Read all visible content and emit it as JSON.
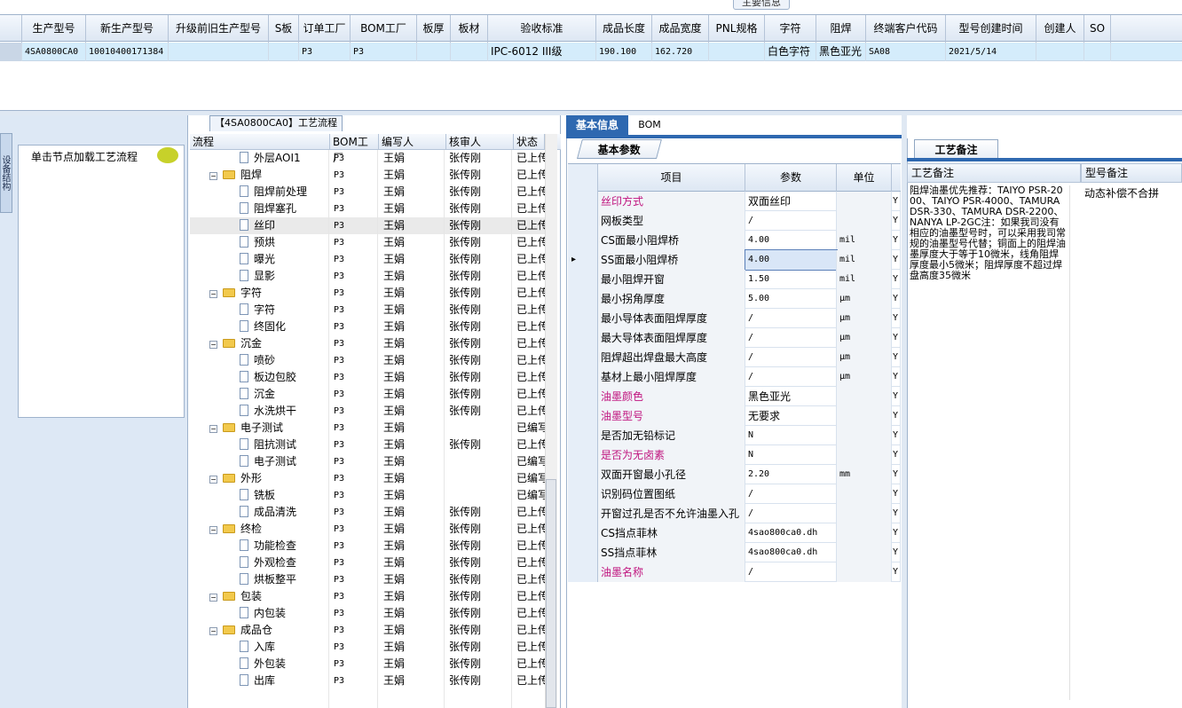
{
  "top": {
    "tab_label": "主要信息",
    "headers": [
      "生产型号",
      "新生产型号",
      "升级前旧生产型号",
      "S板",
      "订单工厂",
      "BOM工厂",
      "板厚",
      "板材",
      "验收标准",
      "成品长度",
      "成品宽度",
      "PNL规格",
      "字符",
      "阻焊",
      "终端客户代码",
      "型号创建时间",
      "创建人",
      "SO"
    ],
    "row": [
      "4SA0800CA0",
      "10010400171384",
      "",
      "",
      "P3",
      "P3",
      "",
      "",
      "IPC-6012 III级",
      "190.100",
      "162.720",
      "",
      "白色字符",
      "黑色亚光",
      "SA08",
      "2021/5/14",
      "",
      ""
    ]
  },
  "left": {
    "side_tab": "设备结构",
    "load_label": "单击节点加载工艺流程"
  },
  "tree": {
    "title": "【4SA0800CA0】工艺流程",
    "headers": [
      "流程",
      "BOM工厂",
      "编写人",
      "核审人",
      "状态"
    ],
    "rows": [
      {
        "name": "外层AOI1",
        "factory": "P3",
        "writer": "王娟",
        "reviewer": "张传刚",
        "status": "已上传",
        "level": 2
      },
      {
        "name": "阻焊",
        "factory": "P3",
        "writer": "王娟",
        "reviewer": "张传刚",
        "status": "已上传",
        "level": 1
      },
      {
        "name": "阻焊前处理",
        "factory": "P3",
        "writer": "王娟",
        "reviewer": "张传刚",
        "status": "已上传",
        "level": 2
      },
      {
        "name": "阻焊塞孔",
        "factory": "P3",
        "writer": "王娟",
        "reviewer": "张传刚",
        "status": "已上传",
        "level": 2
      },
      {
        "name": "丝印",
        "factory": "P3",
        "writer": "王娟",
        "reviewer": "张传刚",
        "status": "已上传",
        "level": 2,
        "selected": true
      },
      {
        "name": "预烘",
        "factory": "P3",
        "writer": "王娟",
        "reviewer": "张传刚",
        "status": "已上传",
        "level": 2
      },
      {
        "name": "曝光",
        "factory": "P3",
        "writer": "王娟",
        "reviewer": "张传刚",
        "status": "已上传",
        "level": 2
      },
      {
        "name": "显影",
        "factory": "P3",
        "writer": "王娟",
        "reviewer": "张传刚",
        "status": "已上传",
        "level": 2
      },
      {
        "name": "字符",
        "factory": "P3",
        "writer": "王娟",
        "reviewer": "张传刚",
        "status": "已上传",
        "level": 1
      },
      {
        "name": "字符",
        "factory": "P3",
        "writer": "王娟",
        "reviewer": "张传刚",
        "status": "已上传",
        "level": 2
      },
      {
        "name": "终固化",
        "factory": "P3",
        "writer": "王娟",
        "reviewer": "张传刚",
        "status": "已上传",
        "level": 2
      },
      {
        "name": "沉金",
        "factory": "P3",
        "writer": "王娟",
        "reviewer": "张传刚",
        "status": "已上传",
        "level": 1
      },
      {
        "name": "喷砂",
        "factory": "P3",
        "writer": "王娟",
        "reviewer": "张传刚",
        "status": "已上传",
        "level": 2
      },
      {
        "name": "板边包胶",
        "factory": "P3",
        "writer": "王娟",
        "reviewer": "张传刚",
        "status": "已上传",
        "level": 2
      },
      {
        "name": "沉金",
        "factory": "P3",
        "writer": "王娟",
        "reviewer": "张传刚",
        "status": "已上传",
        "level": 2
      },
      {
        "name": "水洗烘干",
        "factory": "P3",
        "writer": "王娟",
        "reviewer": "张传刚",
        "status": "已上传",
        "level": 2
      },
      {
        "name": "电子测试",
        "factory": "P3",
        "writer": "王娟",
        "reviewer": "",
        "status": "已编写",
        "level": 1
      },
      {
        "name": "阻抗测试",
        "factory": "P3",
        "writer": "王娟",
        "reviewer": "张传刚",
        "status": "已上传",
        "level": 2
      },
      {
        "name": "电子测试",
        "factory": "P3",
        "writer": "王娟",
        "reviewer": "",
        "status": "已编写",
        "level": 2
      },
      {
        "name": "外形",
        "factory": "P3",
        "writer": "王娟",
        "reviewer": "",
        "status": "已编写",
        "level": 1
      },
      {
        "name": "铣板",
        "factory": "P3",
        "writer": "王娟",
        "reviewer": "",
        "status": "已编写",
        "level": 2
      },
      {
        "name": "成品清洗",
        "factory": "P3",
        "writer": "王娟",
        "reviewer": "张传刚",
        "status": "已上传",
        "level": 2
      },
      {
        "name": "终检",
        "factory": "P3",
        "writer": "王娟",
        "reviewer": "张传刚",
        "status": "已上传",
        "level": 1
      },
      {
        "name": "功能检查",
        "factory": "P3",
        "writer": "王娟",
        "reviewer": "张传刚",
        "status": "已上传",
        "level": 2
      },
      {
        "name": "外观检查",
        "factory": "P3",
        "writer": "王娟",
        "reviewer": "张传刚",
        "status": "已上传",
        "level": 2
      },
      {
        "name": "烘板整平",
        "factory": "P3",
        "writer": "王娟",
        "reviewer": "张传刚",
        "status": "已上传",
        "level": 2
      },
      {
        "name": "包装",
        "factory": "P3",
        "writer": "王娟",
        "reviewer": "张传刚",
        "status": "已上传",
        "level": 1
      },
      {
        "name": "内包装",
        "factory": "P3",
        "writer": "王娟",
        "reviewer": "张传刚",
        "status": "已上传",
        "level": 2
      },
      {
        "name": "成品仓",
        "factory": "P3",
        "writer": "王娟",
        "reviewer": "张传刚",
        "status": "已上传",
        "level": 1
      },
      {
        "name": "入库",
        "factory": "P3",
        "writer": "王娟",
        "reviewer": "张传刚",
        "status": "已上传",
        "level": 2
      },
      {
        "name": "外包装",
        "factory": "P3",
        "writer": "王娟",
        "reviewer": "张传刚",
        "status": "已上传",
        "level": 2
      },
      {
        "name": "出库",
        "factory": "P3",
        "writer": "王娟",
        "reviewer": "张传刚",
        "status": "已上传",
        "level": 2
      }
    ]
  },
  "mid": {
    "tab_basic": "基本信息",
    "tab_bom": "BOM",
    "sub_tab": "基本参数",
    "headers": [
      "项目",
      "参数",
      "单位"
    ],
    "rows": [
      {
        "item": "丝印方式",
        "value": "双面丝印",
        "unit": "",
        "flag": "Y",
        "pink": true
      },
      {
        "item": "网板类型",
        "value": "/",
        "unit": "",
        "flag": "Y"
      },
      {
        "item": "CS面最小阻焊桥",
        "value": "4.00",
        "unit": "mil",
        "flag": "Y"
      },
      {
        "item": "SS面最小阻焊桥",
        "value": "4.00",
        "unit": "mil",
        "flag": "Y",
        "current": true
      },
      {
        "item": "最小阻焊开窗",
        "value": "1.50",
        "unit": "mil",
        "flag": "Y"
      },
      {
        "item": "最小拐角厚度",
        "value": "5.00",
        "unit": "μm",
        "flag": "Y"
      },
      {
        "item": "最小导体表面阻焊厚度",
        "value": "/",
        "unit": "μm",
        "flag": "Y"
      },
      {
        "item": "最大导体表面阻焊厚度",
        "value": "/",
        "unit": "μm",
        "flag": "Y"
      },
      {
        "item": "阻焊超出焊盘最大高度",
        "value": "/",
        "unit": "μm",
        "flag": "Y"
      },
      {
        "item": "基材上最小阻焊厚度",
        "value": "/",
        "unit": "μm",
        "flag": "Y"
      },
      {
        "item": "油墨颜色",
        "value": "黑色亚光",
        "unit": "",
        "flag": "Y",
        "pink": true
      },
      {
        "item": "油墨型号",
        "value": "无要求",
        "unit": "",
        "flag": "Y",
        "pink": true
      },
      {
        "item": "是否加无铅标记",
        "value": "N",
        "unit": "",
        "flag": "Y"
      },
      {
        "item": "是否为无卤素",
        "value": "N",
        "unit": "",
        "flag": "Y",
        "pink": true
      },
      {
        "item": "双面开窗最小孔径",
        "value": "2.20",
        "unit": "mm",
        "flag": "Y"
      },
      {
        "item": "识别码位置图纸",
        "value": "/",
        "unit": "",
        "flag": "Y"
      },
      {
        "item": "开窗过孔是否不允许油墨入孔",
        "value": "/",
        "unit": "",
        "flag": "Y"
      },
      {
        "item": "CS挡点菲林",
        "value": "4sao800ca0.dh",
        "unit": "",
        "flag": "Y"
      },
      {
        "item": "SS挡点菲林",
        "value": "4sao800ca0.dh",
        "unit": "",
        "flag": "Y"
      },
      {
        "item": "油墨名称",
        "value": "/",
        "unit": "",
        "flag": "Y",
        "pink": true
      }
    ]
  },
  "right": {
    "tab": "工艺备注",
    "col1": "工艺备注",
    "col2": "型号备注",
    "note1": "阻焊油墨优先推荐：TAIYO PSR-2000、TAIYO PSR-4000、TAMURA DSR-330、TAMURA DSR-2200、NANYA LP-2GC注：如果我司没有相应的油墨型号时，可以采用我司常规的油墨型号代替；铜面上的阻焊油墨厚度大于等于10微米，线角阻焊厚度最小5微米；阻焊厚度不超过焊盘高度35微米",
    "note2": "动态补偿不合拼"
  },
  "colors": {
    "accent": "#2e68b0",
    "selected_row": "#d4ecfb",
    "pink": "#c0157f"
  }
}
